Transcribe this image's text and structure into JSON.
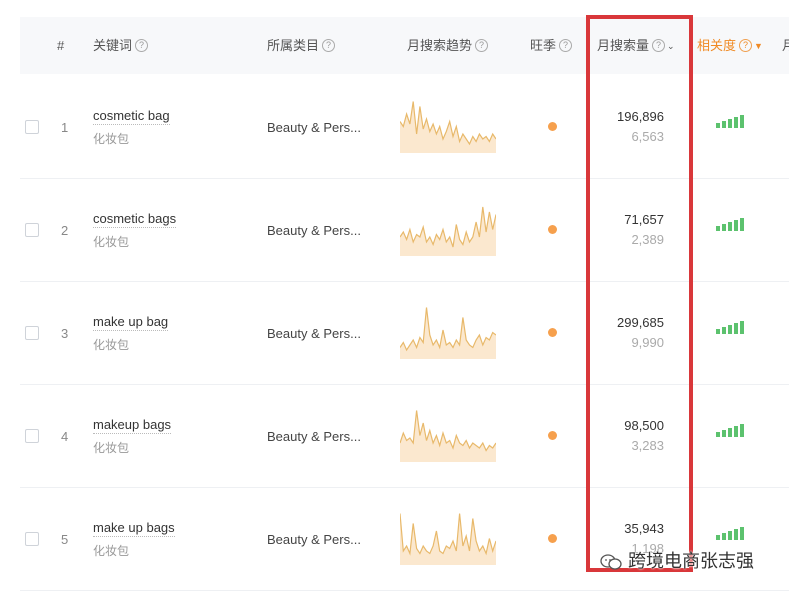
{
  "columns": {
    "index": "#",
    "keyword": "关键词",
    "category": "所属类目",
    "trend": "月搜索趋势",
    "season": "旺季",
    "volume": "月搜索量",
    "relevance": "相关度",
    "next": "月"
  },
  "colors": {
    "accent": "#f08a24",
    "highlight_border": "#d9373a",
    "season_dot": "#f6a04d",
    "relevance_bar": "#5cc26e",
    "sparkline": "#e8b96b"
  },
  "rows": [
    {
      "index": "1",
      "keyword": "cosmetic bag",
      "keyword_cn": "化妆包",
      "category": "Beauty & Pers...",
      "volume": "196,896",
      "volume_sub": "6,563",
      "trend": [
        0.55,
        0.45,
        0.7,
        0.5,
        0.95,
        0.3,
        0.85,
        0.4,
        0.6,
        0.35,
        0.5,
        0.3,
        0.45,
        0.2,
        0.35,
        0.55,
        0.25,
        0.45,
        0.15,
        0.3,
        0.2,
        0.1,
        0.25,
        0.15,
        0.3,
        0.2,
        0.25,
        0.15,
        0.3,
        0.2
      ]
    },
    {
      "index": "2",
      "keyword": "cosmetic bags",
      "keyword_cn": "化妆包",
      "category": "Beauty & Pers...",
      "volume": "71,657",
      "volume_sub": "2,389",
      "trend": [
        0.3,
        0.4,
        0.25,
        0.45,
        0.2,
        0.35,
        0.3,
        0.5,
        0.2,
        0.3,
        0.15,
        0.35,
        0.25,
        0.45,
        0.2,
        0.3,
        0.1,
        0.55,
        0.25,
        0.15,
        0.4,
        0.2,
        0.3,
        0.6,
        0.3,
        0.9,
        0.4,
        0.8,
        0.45,
        0.75
      ]
    },
    {
      "index": "3",
      "keyword": "make up bag",
      "keyword_cn": "化妆包",
      "category": "Beauty & Pers...",
      "volume": "299,685",
      "volume_sub": "9,990",
      "trend": [
        0.15,
        0.25,
        0.1,
        0.2,
        0.3,
        0.15,
        0.35,
        0.25,
        0.95,
        0.4,
        0.2,
        0.3,
        0.15,
        0.5,
        0.2,
        0.25,
        0.15,
        0.3,
        0.2,
        0.75,
        0.3,
        0.2,
        0.15,
        0.3,
        0.4,
        0.2,
        0.35,
        0.3,
        0.45,
        0.4
      ]
    },
    {
      "index": "4",
      "keyword": "makeup bags",
      "keyword_cn": "化妆包",
      "category": "Beauty & Pers...",
      "volume": "98,500",
      "volume_sub": "3,283",
      "trend": [
        0.3,
        0.5,
        0.35,
        0.4,
        0.3,
        0.95,
        0.45,
        0.7,
        0.35,
        0.55,
        0.3,
        0.45,
        0.25,
        0.5,
        0.3,
        0.35,
        0.2,
        0.45,
        0.3,
        0.25,
        0.35,
        0.2,
        0.3,
        0.25,
        0.2,
        0.3,
        0.15,
        0.25,
        0.2,
        0.3
      ]
    },
    {
      "index": "5",
      "keyword": "make up bags",
      "keyword_cn": "化妆包",
      "category": "Beauty & Pers...",
      "volume": "35,943",
      "volume_sub": "1,198",
      "trend": [
        0.95,
        0.2,
        0.3,
        0.15,
        0.75,
        0.25,
        0.15,
        0.3,
        0.2,
        0.15,
        0.3,
        0.6,
        0.2,
        0.15,
        0.3,
        0.25,
        0.4,
        0.2,
        0.95,
        0.3,
        0.5,
        0.2,
        0.85,
        0.4,
        0.2,
        0.3,
        0.15,
        0.45,
        0.2,
        0.4
      ]
    }
  ],
  "watermark": "跨境电商张志强"
}
